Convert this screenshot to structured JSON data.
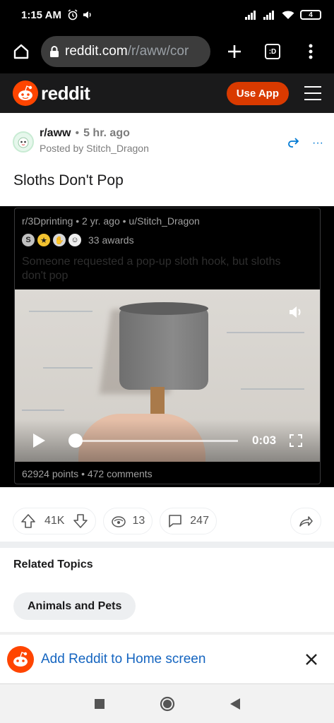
{
  "status_bar": {
    "time": "1:15 AM",
    "battery": "4"
  },
  "browser": {
    "url_host": "reddit.com",
    "url_path": "/r/aww/cor",
    "tabs_label": ":D"
  },
  "header": {
    "logo_text": "reddit",
    "use_app_label": "Use App"
  },
  "post": {
    "subreddit": "r/aww",
    "separator": "•",
    "age": "5 hr. ago",
    "posted_by": "Posted by Stitch_Dragon",
    "more": "···",
    "title": "Sloths Don't Pop"
  },
  "crosspost": {
    "meta": "r/3Dprinting • 2 yr. ago • u/Stitch_Dragon",
    "awards_count": "33 awards",
    "title": "Someone requested a pop-up sloth hook, but sloths don't pop",
    "video_time": "0:03",
    "video_progress": 0.0,
    "stats": "62924 points • 472 comments"
  },
  "actions": {
    "score": "41K",
    "awards": "13",
    "comments": "247"
  },
  "related": {
    "title": "Related Topics",
    "topics": [
      "Animals and Pets"
    ]
  },
  "add_to_home": {
    "label": "Add Reddit to Home screen"
  },
  "colors": {
    "reddit_orange": "#ff4500",
    "use_app": "#d93a00",
    "link_blue": "#1565c0",
    "share_blue": "#0079d3"
  },
  "icons": [
    "alarm-icon",
    "volume-icon",
    "signal-icon",
    "wifi-icon",
    "battery-icon",
    "home-icon",
    "lock-icon",
    "plus-icon",
    "tabs-icon",
    "overflow-menu-icon",
    "hamburger-icon",
    "crosspost-icon",
    "upvote-icon",
    "downvote-icon",
    "award-icon",
    "comment-icon",
    "share-icon",
    "close-icon",
    "play-icon",
    "fullscreen-icon",
    "nav-square-icon",
    "nav-circle-icon",
    "nav-triangle-icon"
  ]
}
